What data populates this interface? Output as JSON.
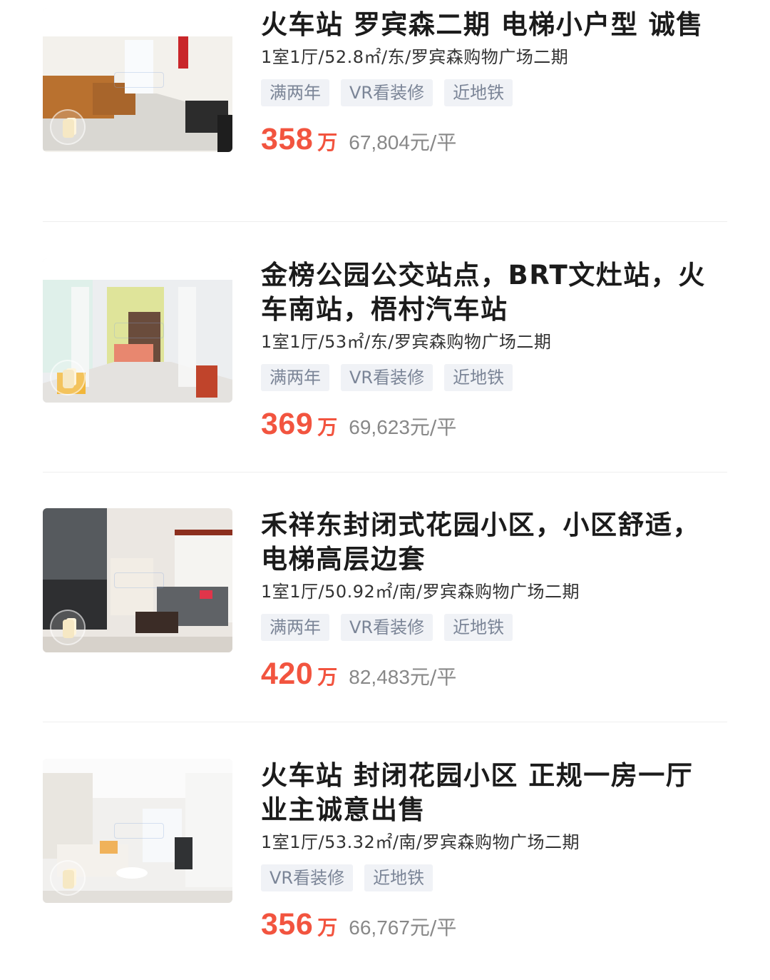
{
  "listings": [
    {
      "title": "火车站 罗宾森二期 电梯小户型 诚售",
      "meta": "1室1厅/52.8㎡/东/罗宾森购物广场二期",
      "tags": [
        "满两年",
        "VR看装修",
        "近地铁"
      ],
      "price_total": "358",
      "price_unit": "万",
      "price_per_value": "67,804",
      "price_per_suffix": "元/平"
    },
    {
      "title": "金榜公园公交站点，BRT文灶站，火车南站，梧村汽车站",
      "meta": "1室1厅/53㎡/东/罗宾森购物广场二期",
      "tags": [
        "满两年",
        "VR看装修",
        "近地铁"
      ],
      "price_total": "369",
      "price_unit": "万",
      "price_per_value": "69,623",
      "price_per_suffix": "元/平"
    },
    {
      "title": "禾祥东封闭式花园小区，小区舒适，电梯高层边套",
      "meta": "1室1厅/50.92㎡/南/罗宾森购物广场二期",
      "tags": [
        "满两年",
        "VR看装修",
        "近地铁"
      ],
      "price_total": "420",
      "price_unit": "万",
      "price_per_value": "82,483",
      "price_per_suffix": "元/平"
    },
    {
      "title": "火车站 封闭花园小区 正规一房一厅 业主诚意出售",
      "meta": "1室1厅/53.32㎡/南/罗宾森购物广场二期",
      "tags": [
        "VR看装修",
        "近地铁"
      ],
      "price_total": "356",
      "price_unit": "万",
      "price_per_value": "66,767",
      "price_per_suffix": "元/平"
    }
  ],
  "colors": {
    "price": "#f2543f",
    "tag_bg": "#f0f2f6",
    "tag_text": "#7b8597",
    "title": "#1b1b1b",
    "meta": "#333333",
    "price_per": "#888888",
    "divider": "#eeeeee"
  },
  "icons": {
    "vr_badge": "vr-view-icon"
  }
}
